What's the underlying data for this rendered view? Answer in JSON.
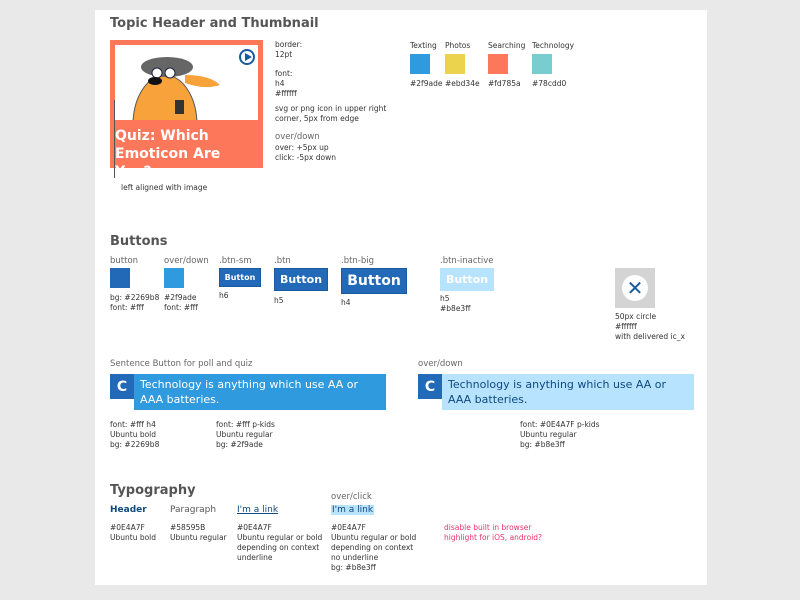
{
  "topic": {
    "heading": "Topic Header and Thumbnail",
    "thumb_title": "Quiz: Which Emoticon Are You?",
    "thumb_icon": "play-circle-icon",
    "notes": {
      "border": "border:\n12pt",
      "font": "font:\nh4\n#ffffff",
      "icon": "svg or png icon in upper right\ncorner, 5px from edge",
      "overdown_label": "over/down",
      "overdown": "over: +5px up\nclick: -5px down"
    },
    "align_note": "left aligned with image",
    "swatches": [
      {
        "label": "Texting",
        "hex": "#2f9ade"
      },
      {
        "label": "Photos",
        "hex": "#ebd34e"
      },
      {
        "label": "Searching",
        "hex": "#fd785a"
      },
      {
        "label": "Technology",
        "hex": "#78cdd0"
      }
    ]
  },
  "buttons": {
    "heading": "Buttons",
    "button": {
      "label": "button",
      "note": "bg: #2269b8\nfont: #fff",
      "color": "#2269b8"
    },
    "overdown": {
      "label": "over/down",
      "note": "#2f9ade\nfont: #fff",
      "color": "#2f9ade"
    },
    "sm": {
      "label": ".btn-sm",
      "text": "Button",
      "note": "h6"
    },
    "btn": {
      "label": ".btn",
      "text": "Button",
      "note": "h5"
    },
    "big": {
      "label": ".btn-big",
      "text": "Button",
      "note": "h4"
    },
    "inactive": {
      "label": ".btn-inactive",
      "text": "Button",
      "note": "h5\n#b8e3ff"
    },
    "close": {
      "icon": "close-icon",
      "note": "50px circle\n#ffffff\nwith delivered ic_x"
    }
  },
  "sentence": {
    "label": "Sentence Button for poll and quiz",
    "letter": "C",
    "text": "Technology is anything which use AA or AAA batteries.",
    "note_letter": "font: #fff h4\nUbuntu bold\nbg: #2269b8",
    "note_text": "font: #fff p-kids\nUbuntu regular\nbg: #2f9ade",
    "over_label": "over/down",
    "over_note": "font: #0E4A7F p-kids\nUbuntu regular\nbg: #b8e3ff"
  },
  "typography": {
    "heading": "Typography",
    "header": "Header",
    "header_note": "#0E4A7F\nUbuntu bold",
    "paragraph": "Paragraph",
    "paragraph_note": "#58595B\nUbuntu regular",
    "link": "I'm a link",
    "link_note": "#0E4A7F\nUbuntu regular or bold\ndepending on context\nunderline",
    "over_label": "over/click",
    "link_over": "I'm a link",
    "link_over_note": "#0E4A7F\nUbuntu regular or bold\ndepending on context\nno underline\nbg: #b8e3ff",
    "warning": "disable built in browser\nhighlight for iOS, android?"
  }
}
